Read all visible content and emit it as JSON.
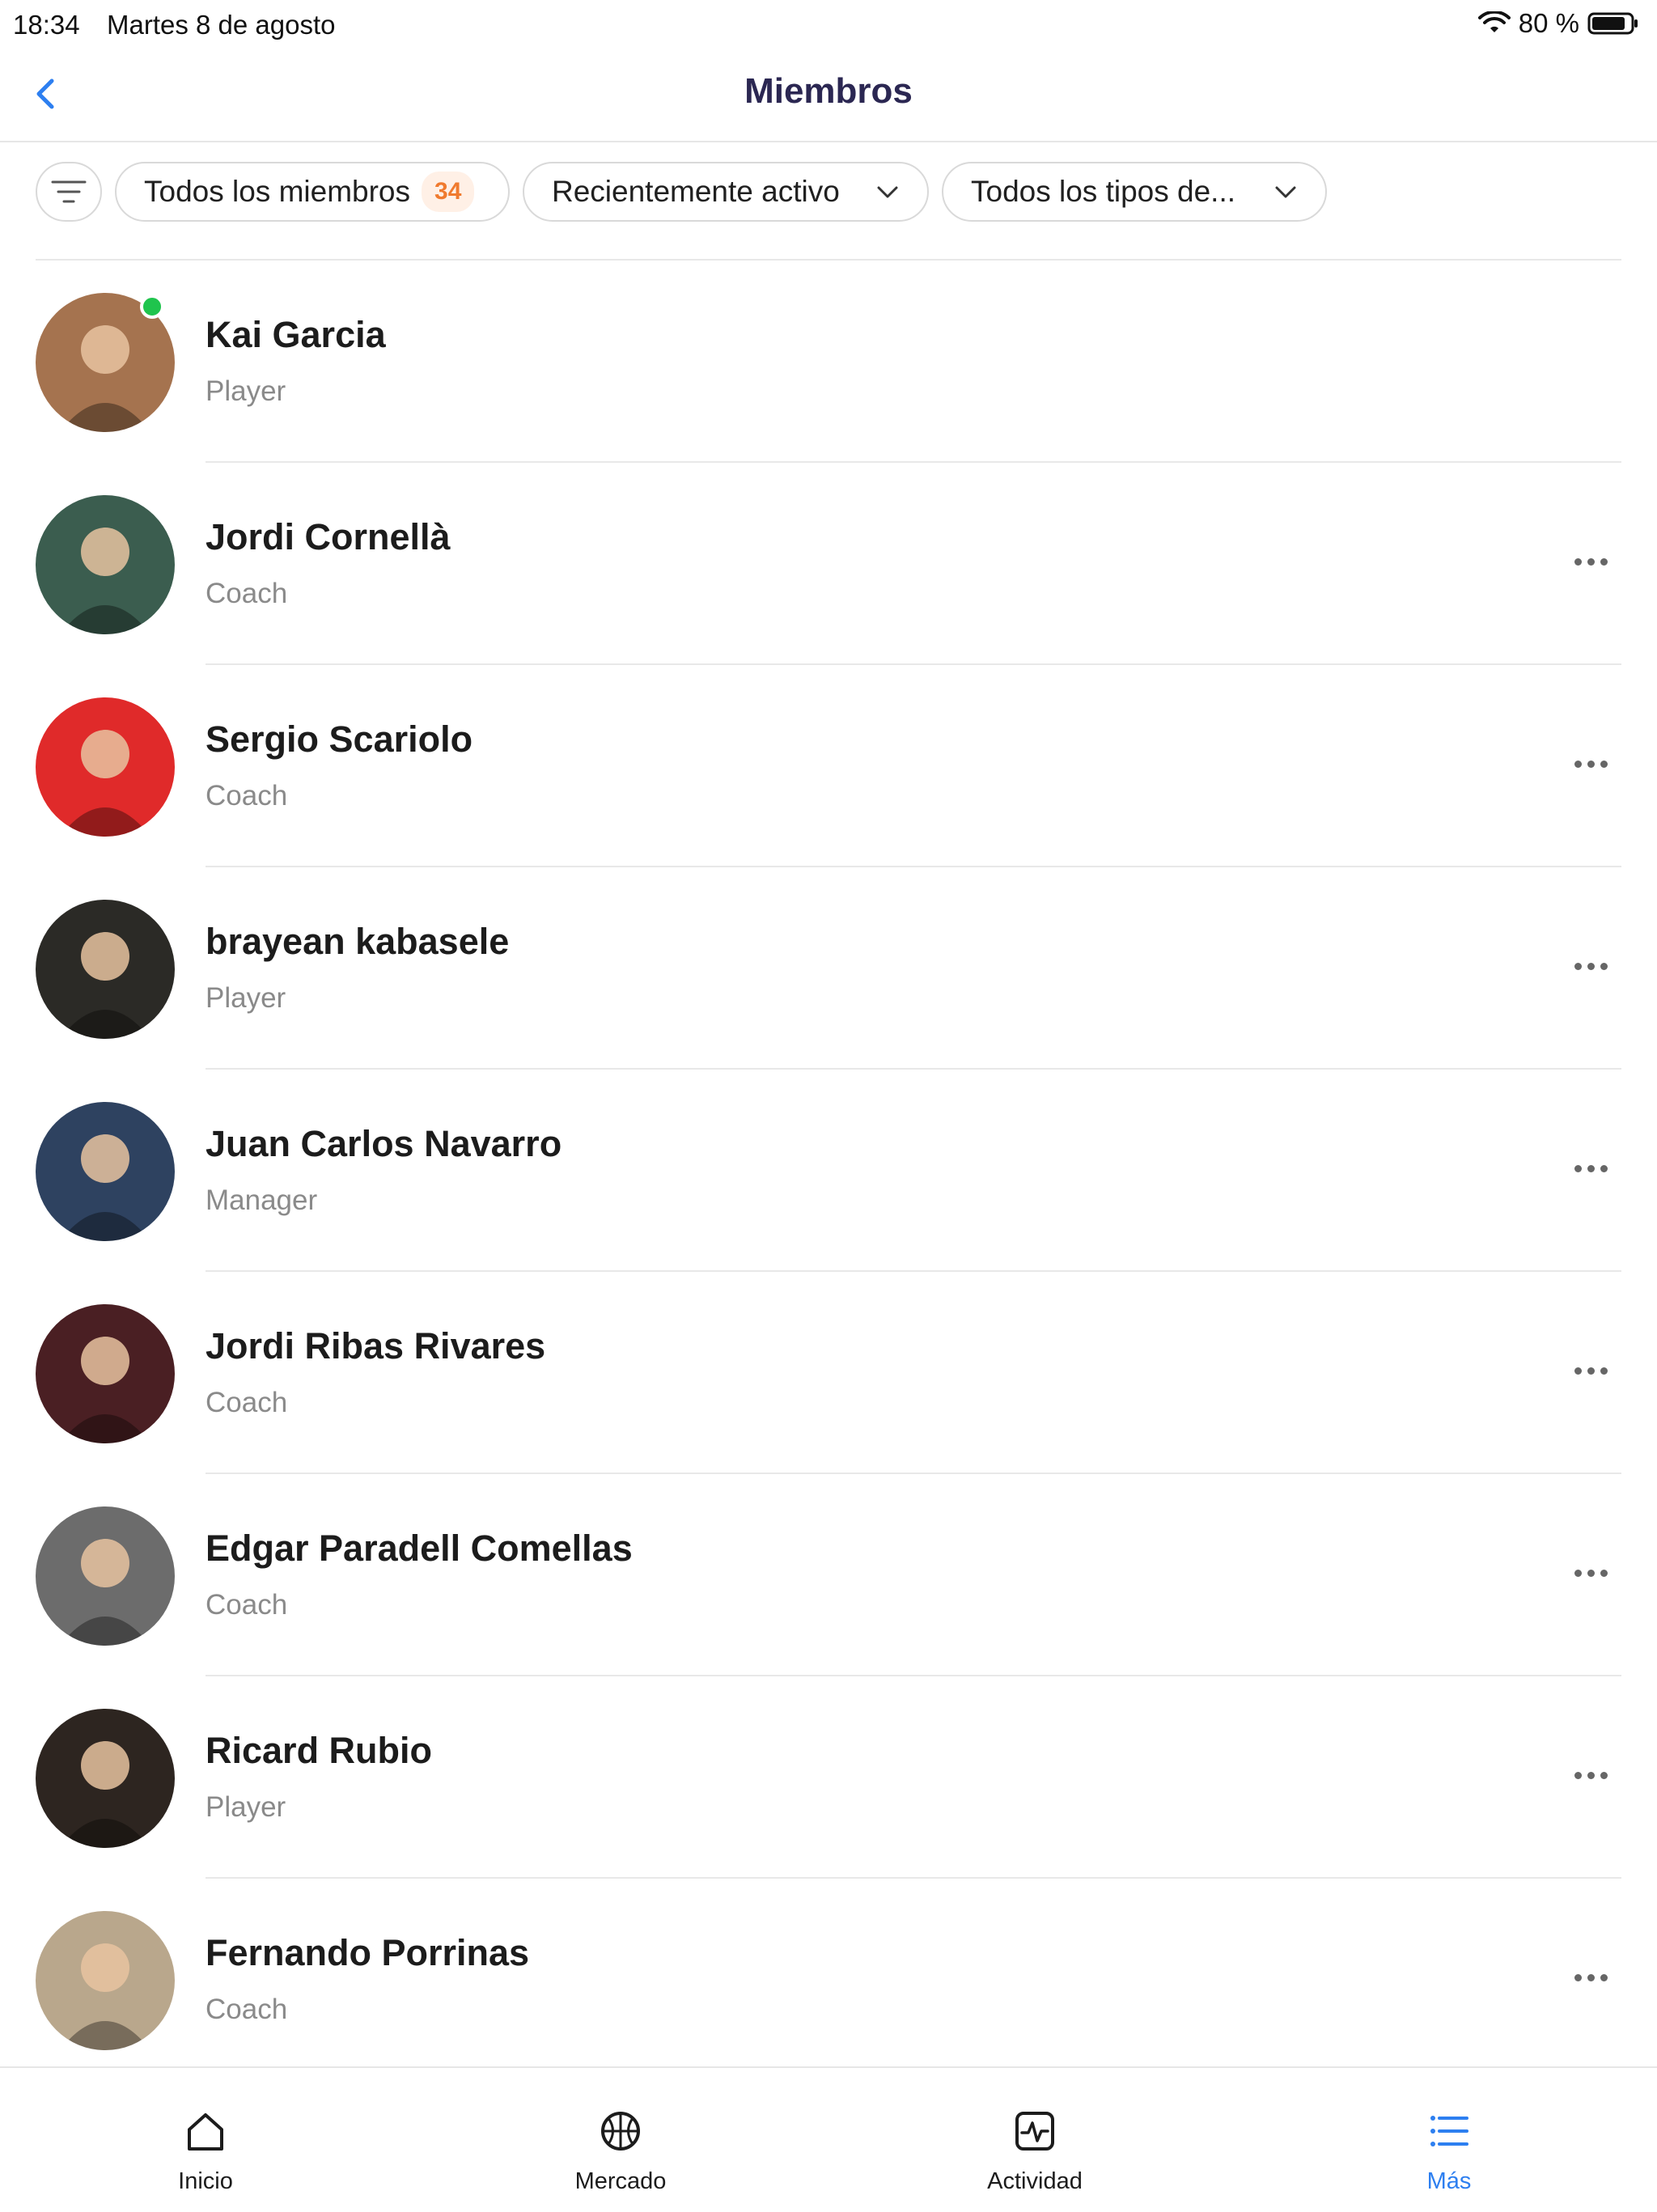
{
  "status_bar": {
    "time": "18:34",
    "date": "Martes 8 de agosto",
    "battery": "80 %"
  },
  "nav": {
    "title": "Miembros"
  },
  "filters": {
    "all_members_label": "Todos los miembros",
    "all_members_count": "34",
    "sort_label": "Recientemente activo",
    "type_label": "Todos los tipos de..."
  },
  "members": [
    {
      "name": "Kai Garcia",
      "role": "Player",
      "online": true,
      "avatar_color": "#a5734f"
    },
    {
      "name": "Jordi Cornellà",
      "role": "Coach",
      "online": false,
      "avatar_color": "#3b5d4f"
    },
    {
      "name": "Sergio Scariolo",
      "role": "Coach",
      "online": false,
      "avatar_color": "#e02a2a"
    },
    {
      "name": "brayean kabasele",
      "role": "Player",
      "online": false,
      "avatar_color": "#2b2a26"
    },
    {
      "name": "Juan Carlos Navarro",
      "role": "Manager",
      "online": false,
      "avatar_color": "#2e4260"
    },
    {
      "name": "Jordi Ribas Rivares",
      "role": "Coach",
      "online": false,
      "avatar_color": "#4a1f23"
    },
    {
      "name": "Edgar Paradell Comellas",
      "role": "Coach",
      "online": false,
      "avatar_color": "#6c6c6c"
    },
    {
      "name": "Ricard Rubio",
      "role": "Player",
      "online": false,
      "avatar_color": "#2d2520"
    },
    {
      "name": "Fernando Porrinas",
      "role": "Coach",
      "online": false,
      "avatar_color": "#b9a78c"
    }
  ],
  "tabs": [
    {
      "label": "Inicio",
      "icon": "home-icon"
    },
    {
      "label": "Mercado",
      "icon": "basketball-icon"
    },
    {
      "label": "Actividad",
      "icon": "activity-icon"
    },
    {
      "label": "Más",
      "icon": "menu-list-icon"
    }
  ],
  "colors": {
    "accent": "#2d7ff0",
    "badge_text": "#f07a2e",
    "online": "#1fc44d",
    "title": "#2b2752"
  }
}
